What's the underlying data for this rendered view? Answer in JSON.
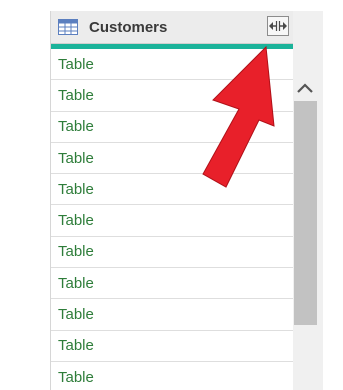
{
  "header": {
    "title": "Customers",
    "column_icon": "table-icon",
    "expand_icon": "expand-column-icon"
  },
  "rows": [
    "Table",
    "Table",
    "Table",
    "Table",
    "Table",
    "Table",
    "Table",
    "Table",
    "Table",
    "Table",
    "Table"
  ],
  "scrollbar": {
    "up_icon": "chevron-up-icon"
  },
  "annotation": {
    "arrow_icon": "red-arrow-icon",
    "color": "#e8202a"
  },
  "colors": {
    "accent": "#1bb39a",
    "cell_text": "#2e7d3a"
  }
}
